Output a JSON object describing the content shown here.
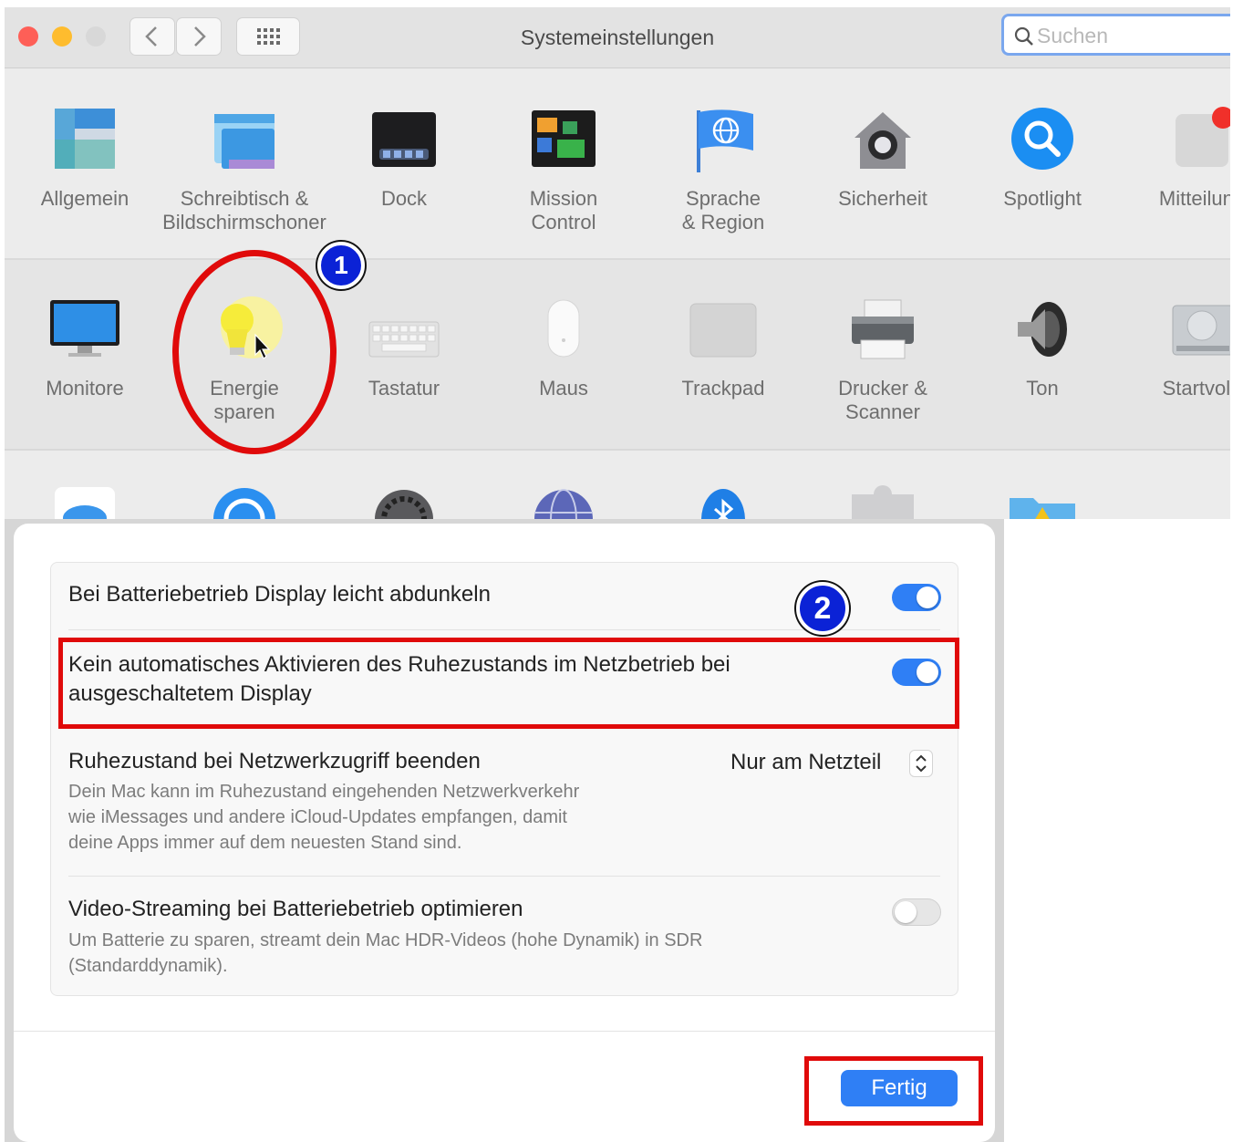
{
  "window": {
    "title": "Systemeinstellungen",
    "search": {
      "placeholder": "Suchen",
      "value": ""
    }
  },
  "rows": [
    {
      "items": [
        {
          "id": "allgemein",
          "label": "Allgemein",
          "icon": "general-icon"
        },
        {
          "id": "schreibtisch",
          "label": "Schreibtisch &\nBildschirmschoner",
          "icon": "desktop-screensaver-icon"
        },
        {
          "id": "dock",
          "label": "Dock",
          "icon": "dock-icon"
        },
        {
          "id": "mission-control",
          "label": "Mission\nControl",
          "icon": "mission-control-icon"
        },
        {
          "id": "sprache-region",
          "label": "Sprache\n& Region",
          "icon": "language-region-icon"
        },
        {
          "id": "sicherheit",
          "label": "Sicherheit",
          "icon": "security-house-icon"
        },
        {
          "id": "spotlight",
          "label": "Spotlight",
          "icon": "spotlight-icon"
        },
        {
          "id": "mitteilungen",
          "label": "Mitteilung",
          "icon": "notifications-icon"
        }
      ]
    },
    {
      "items": [
        {
          "id": "monitore",
          "label": "Monitore",
          "icon": "monitor-icon"
        },
        {
          "id": "energie-sparen",
          "label": "Energie\nsparen",
          "icon": "lightbulb-icon"
        },
        {
          "id": "tastatur",
          "label": "Tastatur",
          "icon": "keyboard-icon"
        },
        {
          "id": "maus",
          "label": "Maus",
          "icon": "mouse-icon"
        },
        {
          "id": "trackpad",
          "label": "Trackpad",
          "icon": "trackpad-icon"
        },
        {
          "id": "drucker-scanner",
          "label": "Drucker &\nScanner",
          "icon": "printer-icon"
        },
        {
          "id": "ton",
          "label": "Ton",
          "icon": "speaker-icon"
        },
        {
          "id": "startvolume",
          "label": "Startvolu",
          "icon": "hard-drive-icon"
        }
      ]
    },
    {
      "items": [
        {
          "id": "icloud",
          "label": "",
          "icon": "icloud-icon"
        },
        {
          "id": "internet-accounts",
          "label": "",
          "icon": "at-sign-icon"
        },
        {
          "id": "softwareupdate",
          "label": "",
          "icon": "gear-icon"
        },
        {
          "id": "netzwerk",
          "label": "",
          "icon": "globe-icon"
        },
        {
          "id": "bluetooth",
          "label": "",
          "icon": "bluetooth-icon"
        },
        {
          "id": "erweiterungen",
          "label": "",
          "icon": "puzzle-icon"
        },
        {
          "id": "freigaben",
          "label": "",
          "icon": "sharing-folder-icon"
        }
      ]
    }
  ],
  "annotations": {
    "step1": "1",
    "step2": "2"
  },
  "energy_sheet": {
    "options": [
      {
        "id": "dim-display",
        "title": "Bei Batteriebetrieb Display leicht abdunkeln",
        "toggle": true
      },
      {
        "id": "prevent-sleep",
        "title": "Kein automatisches Aktivieren des Ruhezustands im Netzbetrieb bei\nausgeschaltetem Display",
        "toggle": true
      },
      {
        "id": "wake-network",
        "title": "Ruhezustand bei Netzwerkzugriff beenden",
        "description": "Dein Mac kann im Ruhezustand eingehenden Netzwerkverkehr\nwie iMessages und andere iCloud-Updates empfangen, damit\ndeine Apps immer auf dem neuesten Stand sind.",
        "select_value": "Nur am Netzteil"
      },
      {
        "id": "video-streaming",
        "title": "Video-Streaming bei Batteriebetrieb optimieren",
        "description": "Um Batterie zu sparen, streamt dein Mac HDR-Videos (hohe Dynamik) in SDR\n(Standarddynamik).",
        "toggle": false
      }
    ],
    "done_label": "Fertig"
  },
  "colors": {
    "accent": "#2f7ff5",
    "annotation_red": "#e00a0a",
    "badge_blue": "#0b22d6"
  }
}
